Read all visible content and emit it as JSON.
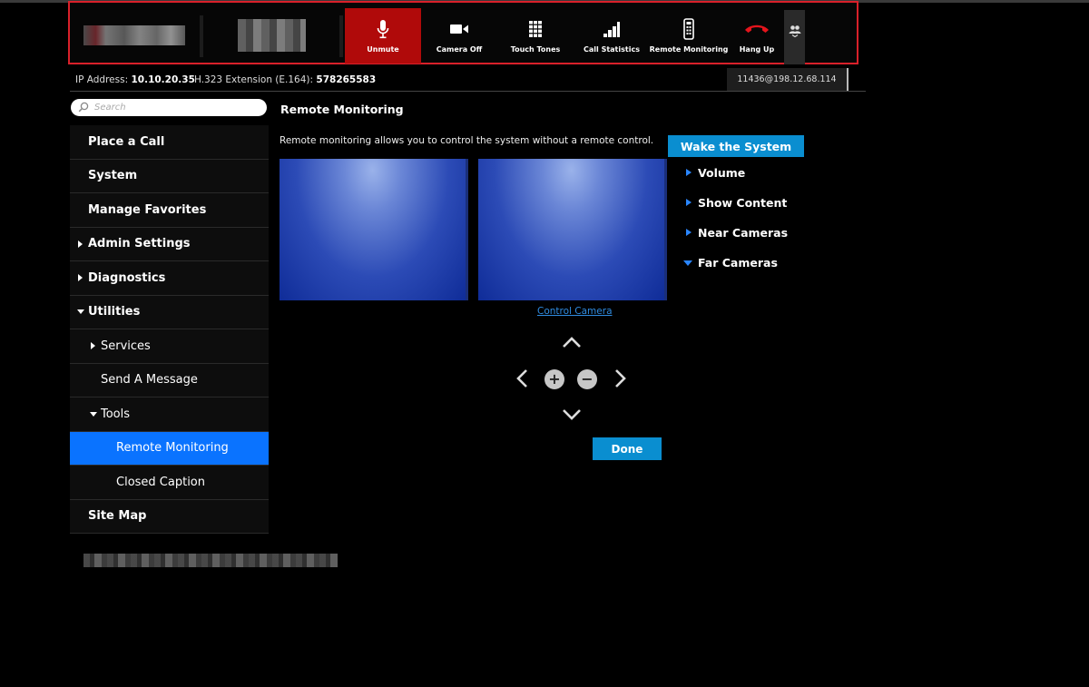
{
  "toolbar": {
    "buttons": [
      {
        "label": "Unmute",
        "icon": "microphone-icon",
        "active": true
      },
      {
        "label": "Camera Off",
        "icon": "video-camera-icon"
      },
      {
        "label": "Touch Tones",
        "icon": "keypad-icon"
      },
      {
        "label": "Call Statistics",
        "icon": "signal-bars-icon"
      },
      {
        "label": "Remote Monitoring",
        "icon": "remote-control-icon"
      },
      {
        "label": "Hang Up",
        "icon": "hang-up-icon"
      }
    ],
    "more_icon": "people-icon",
    "active_color": "#b00a0a"
  },
  "info": {
    "ip_label": "IP Address:",
    "ip_value": "10.10.20.35",
    "ext_label": "H.323 Extension (E.164):",
    "ext_value": "578265583",
    "address": "11436@198.12.68.114"
  },
  "search": {
    "placeholder": "Search"
  },
  "nav": {
    "items": [
      {
        "label": "Place a Call"
      },
      {
        "label": "System"
      },
      {
        "label": "Manage Favorites"
      },
      {
        "label": "Admin Settings"
      },
      {
        "label": "Diagnostics"
      },
      {
        "label": "Utilities"
      },
      {
        "label": "Services"
      },
      {
        "label": "Send A Message"
      },
      {
        "label": "Tools"
      },
      {
        "label": "Remote Monitoring"
      },
      {
        "label": "Closed Caption"
      },
      {
        "label": "Site Map"
      }
    ],
    "selected_color": "#0a73ff"
  },
  "main": {
    "title": "Remote Monitoring",
    "description": "Remote monitoring allows you to control the system without a remote control.",
    "control_link": "Control Camera",
    "zoom_in": "+",
    "zoom_out": "−",
    "done_label": "Done"
  },
  "right_panel": {
    "wake_label": "Wake the System",
    "items": [
      {
        "label": "Volume"
      },
      {
        "label": "Show Content"
      },
      {
        "label": "Near Cameras"
      },
      {
        "label": "Far Cameras"
      }
    ],
    "accent_color": "#0a8ed0"
  }
}
